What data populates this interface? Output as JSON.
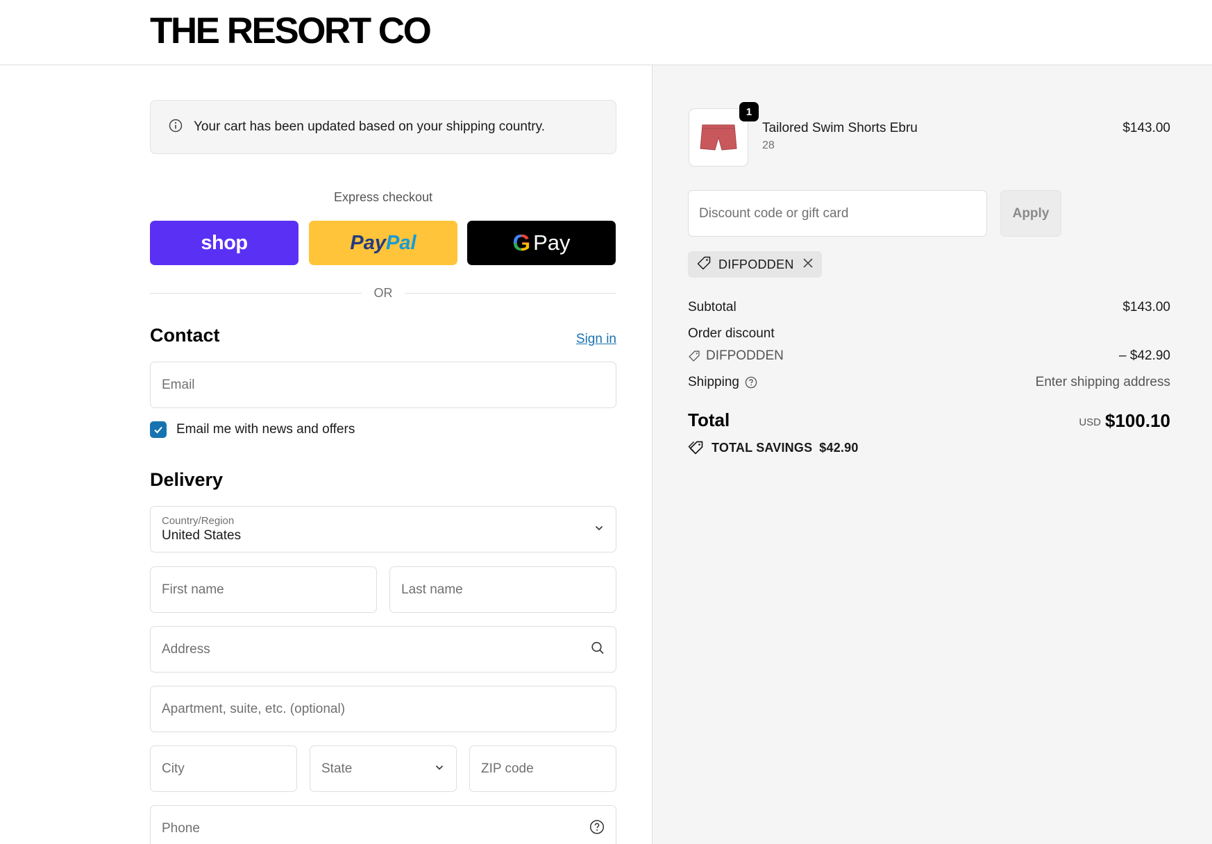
{
  "store": {
    "name": "THE RESORT CO"
  },
  "notice": {
    "icon": "info-icon",
    "text": "Your cart has been updated based on your shipping country."
  },
  "express": {
    "label": "Express checkout",
    "shop_label": "shop",
    "paypal_label_1": "Pay",
    "paypal_label_2": "Pal",
    "gpay_g": "G",
    "gpay_label": "Pay",
    "or_text": "OR"
  },
  "contact": {
    "title": "Contact",
    "sign_in": "Sign in",
    "email_placeholder": "Email",
    "newsletter_label": "Email me with news and offers",
    "newsletter_checked": true
  },
  "delivery": {
    "title": "Delivery",
    "country_label": "Country/Region",
    "country_value": "United States",
    "first_name_placeholder": "First name",
    "last_name_placeholder": "Last name",
    "address_placeholder": "Address",
    "apartment_placeholder": "Apartment, suite, etc. (optional)",
    "city_placeholder": "City",
    "state_placeholder": "State",
    "zip_placeholder": "ZIP code",
    "phone_placeholder": "Phone"
  },
  "summary": {
    "item": {
      "quantity": "1",
      "name": "Tailored Swim Shorts Ebru",
      "variant": "28",
      "price": "$143.00"
    },
    "discount_placeholder": "Discount code or gift card",
    "apply_label": "Apply",
    "applied_code": "DIFPODDEN",
    "subtotal_label": "Subtotal",
    "subtotal_value": "$143.00",
    "order_discount_label": "Order discount",
    "order_discount_code": "DIFPODDEN",
    "order_discount_value": "– $42.90",
    "shipping_label": "Shipping",
    "shipping_value": "Enter shipping address",
    "total_label": "Total",
    "total_currency": "USD",
    "total_value": "$100.10",
    "savings_label": "TOTAL SAVINGS",
    "savings_value": "$42.90"
  },
  "colors": {
    "shop_button": "#5a31f4",
    "paypal_button": "#ffc439",
    "gpay_button": "#000000",
    "link": "#1773b0",
    "checkbox": "#1773b0",
    "product": "#c8585c"
  }
}
